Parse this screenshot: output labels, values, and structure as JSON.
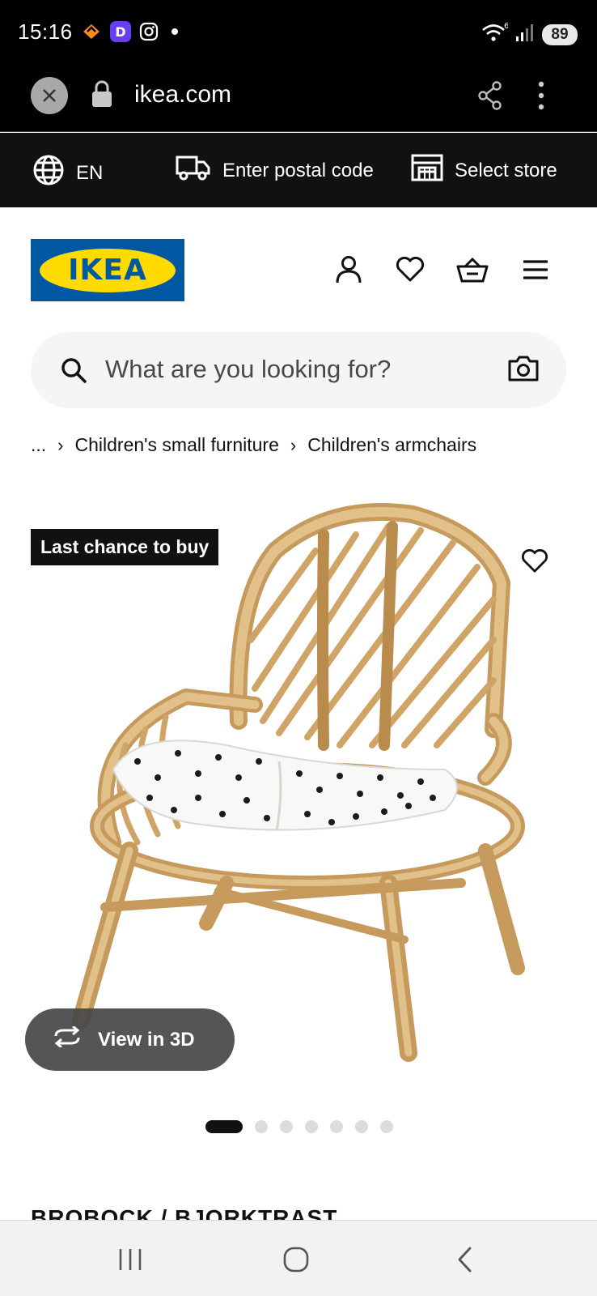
{
  "status_bar": {
    "time": "15:16",
    "battery": "89",
    "network": "6",
    "icons": [
      "heart-tag-icon",
      "d-app-icon",
      "instagram-icon",
      "dot-icon",
      "wifi-icon",
      "signal-icon",
      "battery-icon"
    ]
  },
  "browser": {
    "url": "ikea.com",
    "close_icon": "close-icon",
    "lock_icon": "lock-icon",
    "share_icon": "share-icon",
    "menu_icon": "more-vert-icon"
  },
  "top_strip": {
    "language": "EN",
    "postal_code": "Enter postal code",
    "store": "Select store"
  },
  "header": {
    "logo_text": "IKEA",
    "icons": [
      "user-icon",
      "heart-icon",
      "basket-icon",
      "hamburger-menu-icon"
    ],
    "colors": {
      "logo_blue": "#0058a3",
      "logo_yellow": "#ffdb00"
    }
  },
  "search": {
    "placeholder": "What are you looking for?"
  },
  "breadcrumb": {
    "ellipsis": "...",
    "items": [
      "Children's small furniture",
      "Children's armchairs"
    ]
  },
  "product": {
    "badge": "Last chance to buy",
    "view_3d": "View in 3D",
    "carousel": {
      "total": 7,
      "active": 1
    },
    "title_partial": "BROBOCK / BJÖRKTRAST"
  },
  "nav_bar": {
    "icons": [
      "recent-apps-icon",
      "home-icon",
      "back-icon"
    ]
  }
}
